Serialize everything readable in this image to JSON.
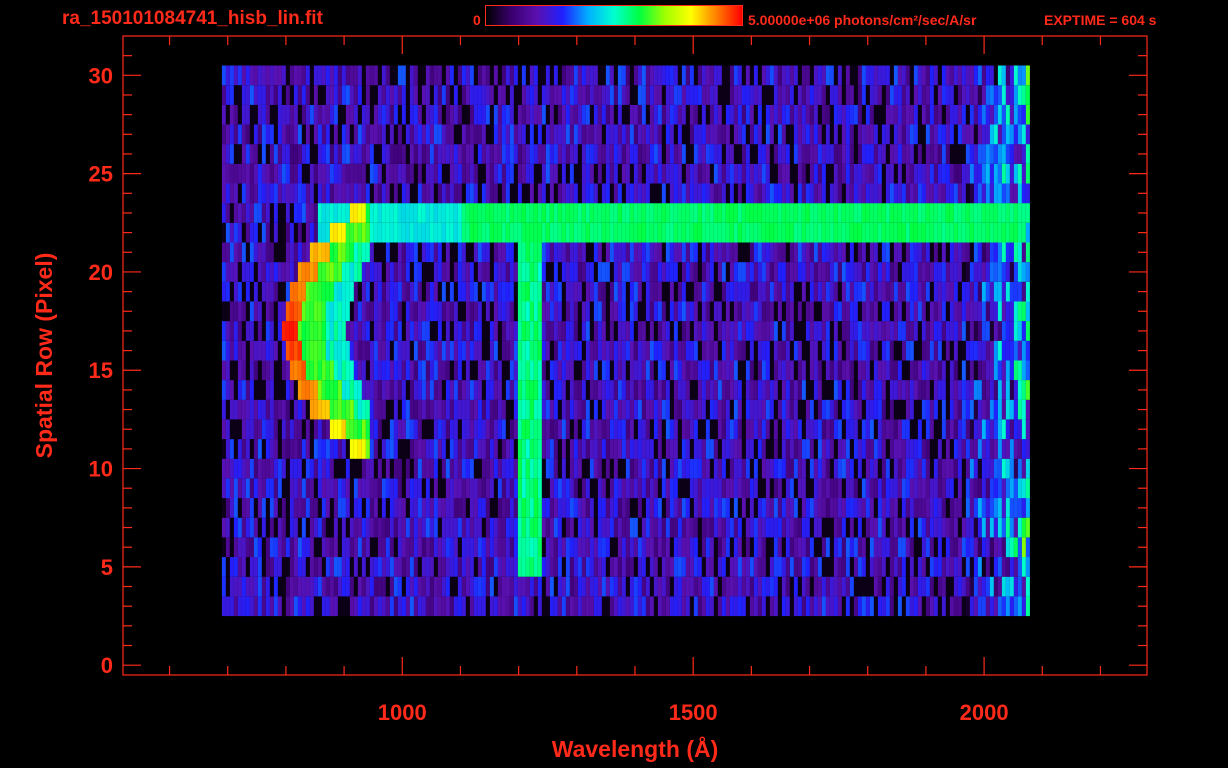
{
  "header": {
    "file_title": "ra_150101084741_hisb_lin.fit",
    "colorbar_min": "0",
    "colorbar_max_label": "5.00000e+06 photons/cm²/sec/A/sr",
    "exptime": "EXPTIME = 604 s"
  },
  "colors": {
    "text": "#ff2a1a",
    "background": "#000000",
    "colormap": [
      "#000000",
      "#3a0070",
      "#5a10b0",
      "#2020ff",
      "#00b0ff",
      "#00ffd0",
      "#00ff40",
      "#a0ff00",
      "#ffff00",
      "#ff8000",
      "#ff0000"
    ]
  },
  "chart_data": {
    "type": "heatmap",
    "title": "ra_150101084741_hisb_lin.fit",
    "xlabel": "Wavelength (Å)",
    "ylabel": "Spatial Row (Pixel)",
    "xlim": [
      520,
      2280
    ],
    "ylim": [
      -0.5,
      32
    ],
    "x_ticks": [
      1000,
      1500,
      2000
    ],
    "y_ticks": [
      0,
      5,
      10,
      15,
      20,
      25,
      30
    ],
    "colorbar": {
      "min": 0,
      "max": 5000000,
      "units": "photons/cm²/sec/A/sr"
    },
    "exposure_time_s": 604,
    "grid": false,
    "data_extent": {
      "x": [
        690,
        2075
      ],
      "rows": [
        3,
        30
      ]
    },
    "features": [
      {
        "name": "",
        "wavelength_range": [
          770,
          940
        ],
        "row_range": [
          11,
          23
        ],
        "peak_rows": [
          14,
          20
        ],
        "peak_value_fraction": 1.0
      },
      {
        "name": "",
        "wavelength": 1216,
        "row_range": [
          5,
          22
        ],
        "value_fraction": 0.55
      },
      {
        "name": "",
        "row_range": [
          22,
          24
        ],
        "wavelength_range": [
          850,
          2070
        ],
        "value_fraction": 0.55
      }
    ]
  }
}
